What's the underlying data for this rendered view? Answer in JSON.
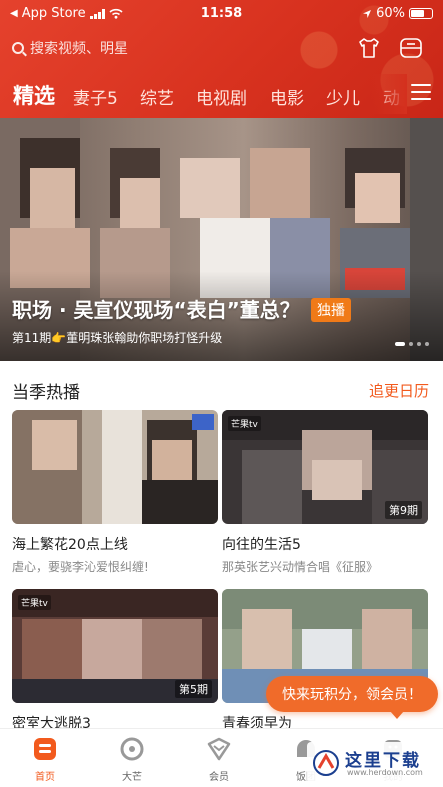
{
  "status_bar": {
    "carrier": "App Store",
    "time": "11:58",
    "battery": "60%"
  },
  "header": {
    "search_placeholder": "搜索视频、明星",
    "tabs": [
      {
        "label": "精选",
        "active": true
      },
      {
        "label": "妻子5",
        "active": false
      },
      {
        "label": "综艺",
        "active": false
      },
      {
        "label": "电视剧",
        "active": false
      },
      {
        "label": "电影",
        "active": false
      },
      {
        "label": "少儿",
        "active": false
      },
      {
        "label": "动",
        "active": false
      }
    ]
  },
  "banner": {
    "title": "职场 · 吴宣仪现场“表白”董总？",
    "badge": "独播",
    "subtitle": "第11期👉董明珠张翰助你职场打怪升级",
    "page_count": 4
  },
  "section": {
    "title": "当季热播",
    "link": "追更日历",
    "cards": [
      {
        "title": "海上繁花20点上线",
        "desc": "虐心，要骁李沁爱恨纠缠!",
        "badge": "",
        "logo": ""
      },
      {
        "title": "向往的生活5",
        "desc": "那英张艺兴动情合唱《征服》",
        "badge": "第9期",
        "logo": "芒果tv"
      },
      {
        "title": "密室大逃脱3",
        "desc": "",
        "badge": "第5期",
        "logo": "芒果tv"
      },
      {
        "title": "青春须早为",
        "desc": "",
        "badge": "",
        "logo": ""
      }
    ]
  },
  "promo": {
    "label": "快来玩积分，领会员！"
  },
  "bottom_nav": [
    {
      "label": "首页",
      "icon": "home-icon",
      "active": true
    },
    {
      "label": "大芒",
      "icon": "daman-icon",
      "active": false
    },
    {
      "label": "会员",
      "icon": "vip-icon",
      "active": false
    },
    {
      "label": "饭团",
      "icon": "fantuan-icon",
      "active": false
    },
    {
      "label": "我的",
      "icon": "profile-icon",
      "active": false
    }
  ],
  "watermark": {
    "text": "这里下载",
    "url": "www.herdown.com"
  },
  "colors": {
    "brand": "#e5422d",
    "accent": "#f25a1d",
    "exclusive_badge": "#f07a18"
  }
}
